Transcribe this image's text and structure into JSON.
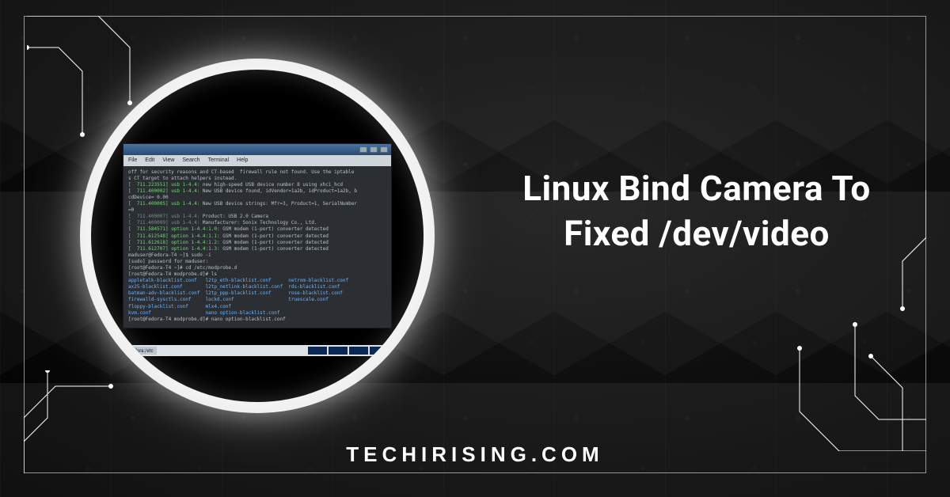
{
  "title": "Linux Bind Camera To Fixed /dev/video",
  "brand": "TECHIRISING.COM",
  "terminal": {
    "menubar": [
      "File",
      "Edit",
      "View",
      "Search",
      "Terminal",
      "Help"
    ],
    "lines": [
      {
        "cls": "",
        "text": "off for security reasons and CT-based  firewall rule not found. Use the iptable"
      },
      {
        "cls": "",
        "text": "s CT target to attach helpers instead."
      },
      {
        "cls": "k-green",
        "pre": "[  711.223551] ",
        "tag": "usb 1-4.4:",
        "rest": " new high-speed USB device number 8 using xhci_hcd"
      },
      {
        "cls": "k-green",
        "pre": "[  711.400002] ",
        "tag": "usb 1-4.4:",
        "rest": " New USB device found, idVendor=1a2b, idProduct=1a2b, b"
      },
      {
        "cls": "",
        "text": "cdDevice= 0.00"
      },
      {
        "cls": "k-green",
        "pre": "[  711.400005] ",
        "tag": "usb 1-4.4:",
        "rest": " New USB device strings: Mfr=3, Product=1, SerialNumber"
      },
      {
        "cls": "",
        "text": "=0"
      },
      {
        "cls": "k-dim",
        "pre": "[  711.400007] ",
        "tag": "usb 1-4.4:",
        "rest": " Product: USB 2.0 Camera"
      },
      {
        "cls": "k-dim",
        "pre": "[  711.400009] ",
        "tag": "usb 1-4.4:",
        "rest": " Manufacturer: Sonix Technology Co., Ltd."
      },
      {
        "cls": "k-green",
        "pre": "[  711.584571] ",
        "tag": "option 1-4.4:1.0:",
        "rest": " GSM modem (1-port) converter detected"
      },
      {
        "cls": "k-green",
        "pre": "[  711.612548] ",
        "tag": "option 1-4.4:1.1:",
        "rest": " GSM modem (1-port) converter detected"
      },
      {
        "cls": "k-green",
        "pre": "[  711.612618] ",
        "tag": "option 1-4.4:1.2:",
        "rest": " GSM modem (1-port) converter detected"
      },
      {
        "cls": "k-green",
        "pre": "[  711.612707] ",
        "tag": "option 1-4.4:1.3:",
        "rest": " GSM modem (1-port) converter detected"
      },
      {
        "cls": "",
        "text": "maduser@Fedora-T4 ~]$ sudo -i"
      },
      {
        "cls": "",
        "text": "[sudo] password for maduser:"
      },
      {
        "cls": "",
        "text": "[root@Fedora-T4 ~]# cd /etc/modprobe.d"
      },
      {
        "cls": "",
        "text": "[root@Fedora-T4 modprobe.d]# ls"
      },
      {
        "cls": "k-blue",
        "text": "appletalk-blacklist.conf   l2tp_eth-blacklist.conf      netrom-blacklist.conf"
      },
      {
        "cls": "k-blue",
        "text": "ax25-blacklist.conf        l2tp_netlink-blacklist.conf  rds-blacklist.conf"
      },
      {
        "cls": "k-blue",
        "text": "batman-adv-blacklist.conf  l2tp_ppp-blacklist.conf      rose-blacklist.conf"
      },
      {
        "cls": "k-blue",
        "text": "firewalld-sysctls.conf     lockd.conf                   truescale.conf"
      },
      {
        "cls": "k-blue",
        "text": "floppy-blacklist.conf      mlx4.conf"
      },
      {
        "cls": "k-blue",
        "text": "kvm.conf                   nano option-blacklist.conf"
      },
      {
        "cls": "",
        "text": "[root@Fedora-T4 modprobe.d]# nano option-blacklist.conf"
      }
    ],
    "taskbar_item": "Fedora:/etc"
  }
}
